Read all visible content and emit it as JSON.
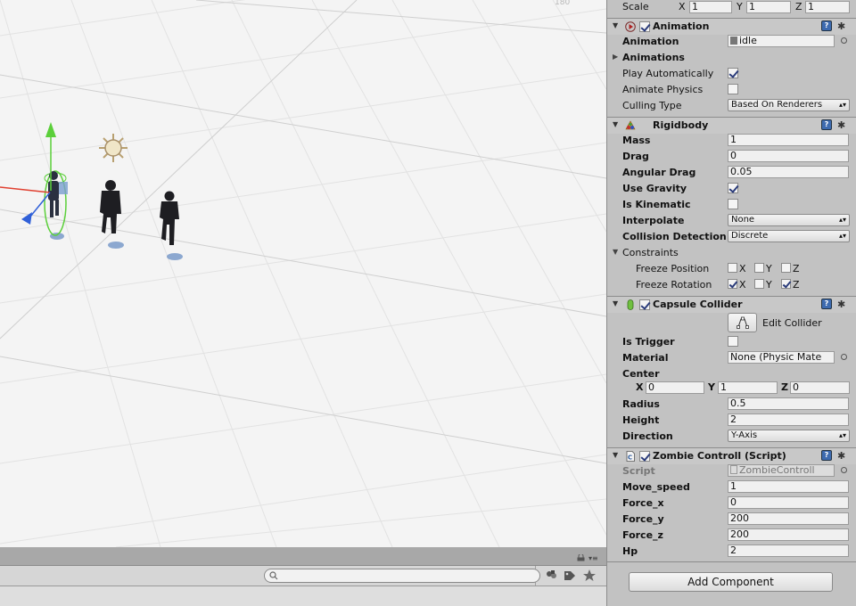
{
  "scene": {
    "corner_label": "180"
  },
  "inspector": {
    "transform": {
      "scale_label": "Scale",
      "x": "1",
      "y": "1",
      "z": "1"
    },
    "animation": {
      "title": "Animation",
      "enabled": true,
      "animation_label": "Animation",
      "animation_value": "idle",
      "animations_label": "Animations",
      "play_auto_label": "Play Automatically",
      "play_auto": true,
      "animate_physics_label": "Animate Physics",
      "animate_physics": false,
      "culling_label": "Culling Type",
      "culling_value": "Based On Renderers"
    },
    "rigidbody": {
      "title": "Rigidbody",
      "mass_label": "Mass",
      "mass": "1",
      "drag_label": "Drag",
      "drag": "0",
      "angular_drag_label": "Angular Drag",
      "angular_drag": "0.05",
      "use_gravity_label": "Use Gravity",
      "use_gravity": true,
      "is_kinematic_label": "Is Kinematic",
      "is_kinematic": false,
      "interpolate_label": "Interpolate",
      "interpolate": "None",
      "collision_label": "Collision Detection",
      "collision": "Discrete",
      "constraints_label": "Constraints",
      "freeze_pos_label": "Freeze Position",
      "freeze_rot_label": "Freeze Rotation",
      "x_label": "X",
      "y_label": "Y",
      "z_label": "Z"
    },
    "capsule": {
      "title": "Capsule Collider",
      "enabled": true,
      "edit_label": "Edit Collider",
      "is_trigger_label": "Is Trigger",
      "is_trigger": false,
      "material_label": "Material",
      "material": "None (Physic Mate",
      "center_label": "Center",
      "cx": "0",
      "cy": "1",
      "cz": "0",
      "x_label": "X",
      "y_label": "Y",
      "z_label": "Z",
      "radius_label": "Radius",
      "radius": "0.5",
      "height_label": "Height",
      "height": "2",
      "direction_label": "Direction",
      "direction": "Y-Axis"
    },
    "script": {
      "title": "Zombie Controll (Script)",
      "enabled": true,
      "script_label": "Script",
      "script_value": "ZombieControll",
      "move_speed_label": "Move_speed",
      "move_speed": "1",
      "force_x_label": "Force_x",
      "force_x": "0",
      "force_y_label": "Force_y",
      "force_y": "200",
      "force_z_label": "Force_z",
      "force_z": "200",
      "hp_label": "Hp",
      "hp": "2"
    },
    "add_component_label": "Add Component"
  },
  "colors": {
    "inspector_bg": "#c2c2c2",
    "scene_bg": "#f4f4f4",
    "gizmo_green": "#5bcf3a",
    "gizmo_red": "#e04030",
    "gizmo_blue": "#3060d8",
    "check_mark": "#2a3b7a"
  }
}
